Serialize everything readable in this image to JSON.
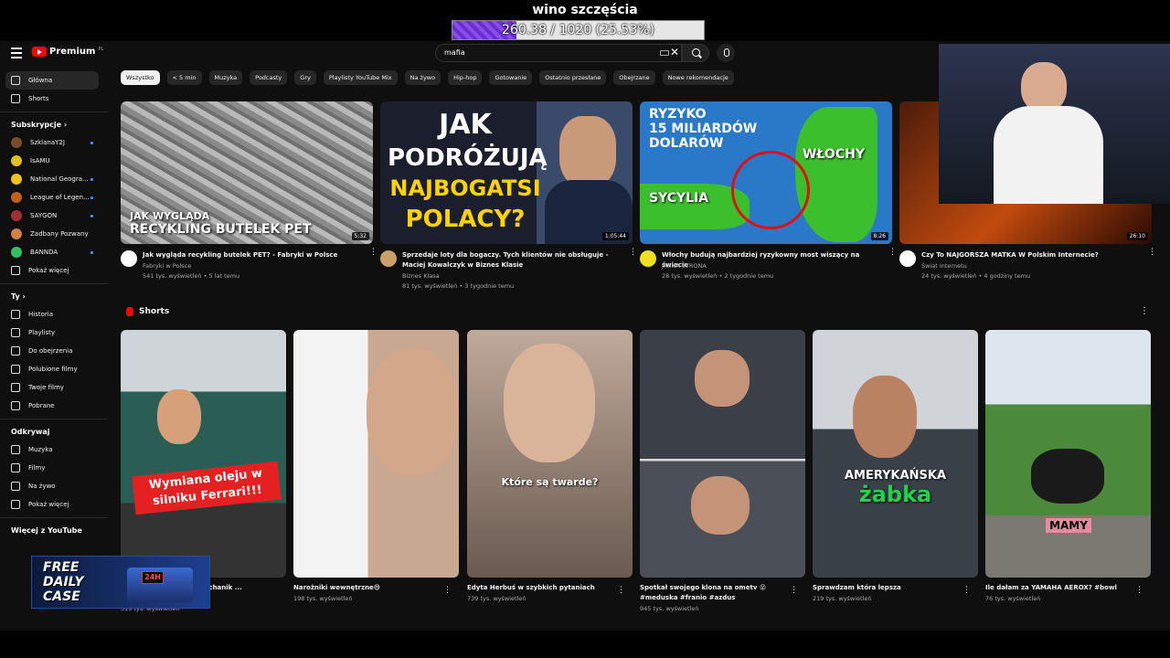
{
  "overlay": {
    "goal_title": "wino szczęścia",
    "goal_text": "260.38 / 1020 (25.53%)",
    "goal_fraction": 0.2553
  },
  "header": {
    "logo_text": "Premium",
    "logo_region": "PL",
    "search_value": "mafia"
  },
  "sidebar": {
    "main": [
      {
        "label": "Główna",
        "icon": "home-icon"
      },
      {
        "label": "Shorts",
        "icon": "shorts-icon"
      }
    ],
    "subscriptions_heading": "Subskrypcje",
    "subscriptions": [
      {
        "label": "SzklanaY2J",
        "color": "#7a4a2a"
      },
      {
        "label": "IsAMU",
        "color": "#e0c020"
      },
      {
        "label": "National Geogra...",
        "color": "#f0c020"
      },
      {
        "label": "League of Legen...",
        "color": "#c06020"
      },
      {
        "label": "SAYGON",
        "color": "#a03030"
      },
      {
        "label": "Zadbany Pozwany",
        "color": "#d08040"
      },
      {
        "label": "BANNDA",
        "color": "#30c060"
      }
    ],
    "show_more": "Pokaż więcej",
    "you_heading": "Ty",
    "you": [
      {
        "label": "Historia",
        "icon": "history-icon"
      },
      {
        "label": "Playlisty",
        "icon": "playlist-icon"
      },
      {
        "label": "Do obejrzenia",
        "icon": "watch-later-icon"
      },
      {
        "label": "Polubione filmy",
        "icon": "like-icon"
      },
      {
        "label": "Twoje filmy",
        "icon": "your-videos-icon"
      },
      {
        "label": "Pobrane",
        "icon": "download-icon"
      }
    ],
    "explore_heading": "Odkrywaj",
    "explore": [
      {
        "label": "Muzyka",
        "icon": "music-icon"
      },
      {
        "label": "Filmy",
        "icon": "film-icon"
      },
      {
        "label": "Na żywo",
        "icon": "live-icon"
      },
      {
        "label": "Pokaż więcej",
        "icon": "chevron-down-icon"
      }
    ],
    "more_heading": "Więcej z YouTube"
  },
  "chips": [
    "Wszystko",
    "< 5 min",
    "Muzyka",
    "Podcasty",
    "Gry",
    "Playlisty YouTube Mix",
    "Na żywo",
    "Hip-hop",
    "Gotowanie",
    "Ostatnio przesłane",
    "Obejrzane",
    "Nowe rekomendacje"
  ],
  "videos": [
    {
      "title": "Jak wygląda recykling butelek PET? - Fabryki w Polsce",
      "channel": "Fabryki w Polsce",
      "meta": "541 tys. wyświetleń • 5 lat temu",
      "duration": "5:32",
      "thumb_text1": "JAK WYGLĄDA",
      "thumb_text2": "RECYKLING BUTELEK PET"
    },
    {
      "title": "Sprzedaje loty dla bogaczy. Tych klientów nie obsługuje - Maciej Kowalczyk w Biznes Klasie",
      "channel": "Biznes Klasa",
      "meta": "81 tys. wyświetleń • 3 tygodnie temu",
      "duration": "1:05:44",
      "thumb_lines": [
        "JAK",
        "PODRÓŻUJĄ",
        "NAJBOGATSI",
        "POLACY?"
      ]
    },
    {
      "title": "Włochy budują najbardziej ryzykowny most wiszący na świecie",
      "channel": "JASNA STRONA",
      "meta": "28 tys. wyświetleń • 2 tygodnie temu",
      "duration": "8:26",
      "thumb_text1": "RYZYKO",
      "thumb_text2": "15 MILIARDÓW",
      "thumb_text3": "DOLARÓW",
      "thumb_left": "SYCYLIA",
      "thumb_right": "WŁOCHY"
    },
    {
      "title": "Czy To NAJGORSZA MATKA W Polskim Internecie?",
      "channel": "Świat Internetu",
      "meta": "24 tys. wyświetleń • 4 godziny temu",
      "duration": "26:10"
    }
  ],
  "shorts_heading": "Shorts",
  "shorts": [
    {
      "title": "...ffe Romeo z ...cja #mechanik ...",
      "meta": "319 tys. wyświetleń",
      "caption": "Wymiana oleju w silniku Ferrari!!!"
    },
    {
      "title": "Narożniki wewnętrzne😅",
      "meta": "198 tys. wyświetleń"
    },
    {
      "title": "Edyta Herbuś w szybkich pytaniach",
      "meta": "739 tys. wyświetleń",
      "caption": "Które są twarde?"
    },
    {
      "title": "Spotkał swojego klona na ometv 😮 #meduska #franio #azdus",
      "meta": "945 tys. wyświetleń"
    },
    {
      "title": "Sprawdzam która lepsza",
      "meta": "219 tys. wyświetleń",
      "caption1": "AMERYKAŃSKA",
      "caption2": "żabka"
    },
    {
      "title": "Ile dałam za YAMAHA AEROX? #bowl",
      "meta": "76 tys. wyświetleń",
      "caption": "MAMY"
    }
  ],
  "case_ad": {
    "line1": "FREE",
    "line2": "DAILY",
    "line3": "CASE",
    "badge": "24H"
  }
}
